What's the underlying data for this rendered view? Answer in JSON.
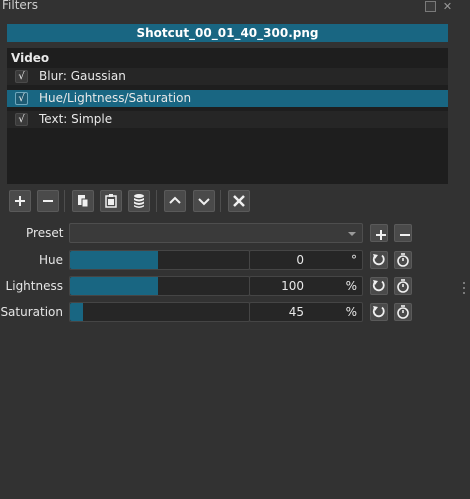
{
  "dock": {
    "title": "Filters"
  },
  "clip": {
    "name": "Shotcut_00_01_40_300.png"
  },
  "filters": {
    "section": "Video",
    "items": [
      {
        "label": "Blur: Gaussian",
        "checked": true,
        "check_glyph": "√"
      },
      {
        "label": "Hue/Lightness/Saturation",
        "checked": true,
        "check_glyph": "√",
        "selected": true
      },
      {
        "label": "Text: Simple",
        "checked": true,
        "check_glyph": "√"
      }
    ]
  },
  "toolbar": {
    "buttons": [
      "add-filter",
      "remove-filter",
      "copy-filters",
      "paste-filters",
      "save-preset",
      "move-up",
      "move-down",
      "deselect"
    ]
  },
  "preset": {
    "label": "Preset",
    "value": ""
  },
  "params": {
    "hue": {
      "label": "Hue",
      "value": "0",
      "unit": "°",
      "fill_fraction": 0.49
    },
    "lightness": {
      "label": "Lightness",
      "value": "100",
      "unit": "%",
      "fill_fraction": 0.49
    },
    "saturation": {
      "label": "Saturation",
      "value": "45",
      "unit": "%",
      "fill_fraction": 0.07
    }
  },
  "colors": {
    "accent": "#196682",
    "background": "#323232",
    "list_background": "#1e1e1e"
  }
}
